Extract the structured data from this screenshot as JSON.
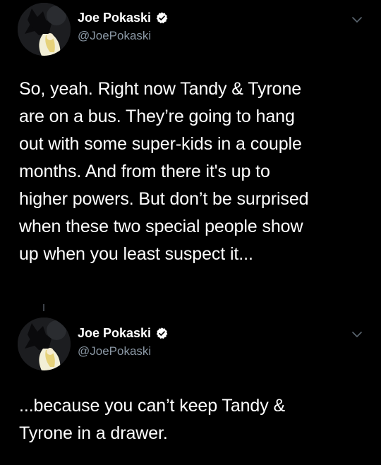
{
  "tweets": [
    {
      "display_name": "Joe Pokaski",
      "handle": "@JoePokaski",
      "verified": true,
      "text": "So, yeah.  Right now Tandy & Tyrone\nare on a bus.  They’re going to hang\nout with some super-kids in a couple\nmonths.  And from there it's up to\nhigher powers.  But don’t be surprised\nwhen these two special people show\nup when you least suspect it..."
    },
    {
      "display_name": "Joe Pokaski",
      "handle": "@JoePokaski",
      "verified": true,
      "text": "...because you can’t keep Tandy &\nTyrone in a drawer."
    }
  ],
  "icons": {
    "verified": "verified-badge-icon",
    "menu": "chevron-down-icon"
  },
  "colors": {
    "background": "#000000",
    "text": "#ffffff",
    "handle": "#8b98a5",
    "verified_badge": "#ffffff",
    "chevron": "#5b6670"
  }
}
